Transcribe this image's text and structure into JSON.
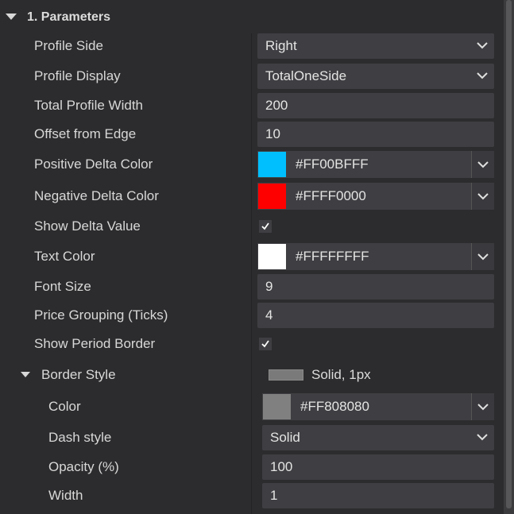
{
  "section": {
    "title": "1. Parameters"
  },
  "rows": [
    {
      "label": "Profile Side",
      "value": "Right"
    },
    {
      "label": "Profile Display",
      "value": "TotalOneSide"
    },
    {
      "label": "Total Profile Width",
      "value": "200"
    },
    {
      "label": "Offset from Edge",
      "value": "10"
    },
    {
      "label": "Positive Delta Color",
      "value": "#FF00BFFF",
      "swatch": "#00bfff"
    },
    {
      "label": "Negative Delta Color",
      "value": "#FFFF0000",
      "swatch": "#ff0000"
    },
    {
      "label": "Show Delta Value",
      "checked": true
    },
    {
      "label": "Text Color",
      "value": "#FFFFFFFF",
      "swatch": "#ffffff"
    },
    {
      "label": "Font Size",
      "value": "9"
    },
    {
      "label": "Price Grouping (Ticks)",
      "value": "4"
    },
    {
      "label": "Show Period Border",
      "checked": true
    }
  ],
  "border_style": {
    "label": "Border Style",
    "summary": "Solid, 1px",
    "preview_color": "#808080",
    "color": {
      "label": "Color",
      "value": "#FF808080",
      "swatch": "#808080"
    },
    "dash": {
      "label": "Dash style",
      "value": "Solid"
    },
    "opacity": {
      "label": "Opacity (%)",
      "value": "100"
    },
    "width": {
      "label": "Width",
      "value": "1"
    }
  },
  "icons": {
    "expand": "triangle-down-icon",
    "dropdown": "chevron-down-icon",
    "check": "checkmark-icon"
  }
}
